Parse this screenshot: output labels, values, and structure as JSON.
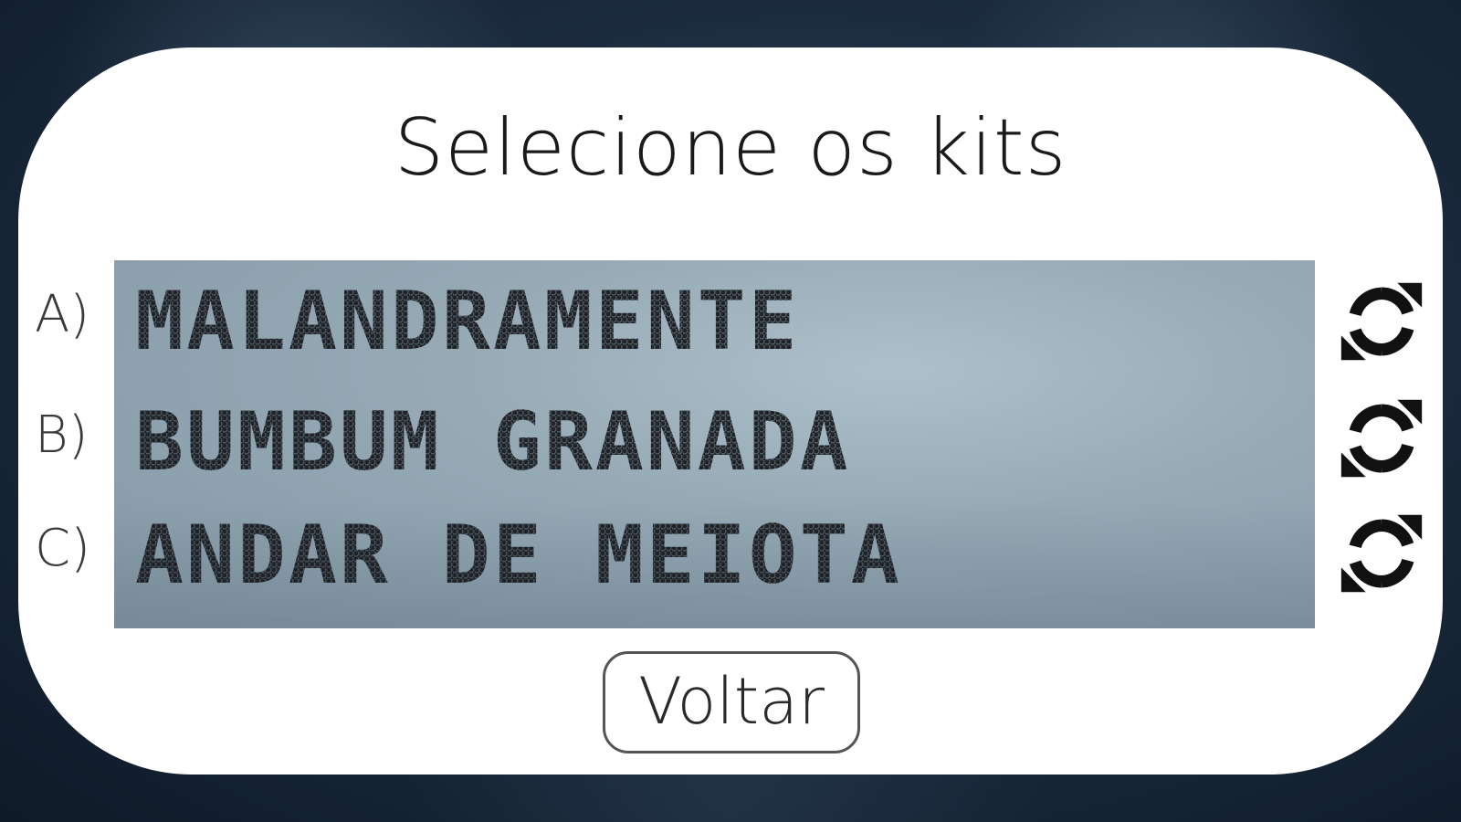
{
  "screen": {
    "title": "Selecione os kits",
    "back_label": "Voltar"
  },
  "kits": [
    {
      "label": "A)",
      "name": "MALANDRAMENTE",
      "refresh_icon": "refresh-icon"
    },
    {
      "label": "B)",
      "name": "BUMBUM GRANADA",
      "refresh_icon": "refresh-icon"
    },
    {
      "label": "C)",
      "name": "ANDAR DE MEIOTA",
      "refresh_icon": "refresh-icon"
    }
  ],
  "colors": {
    "panel": "#ffffff",
    "display": "#98a8b4",
    "dot_matrix_text": "#1e2226",
    "background": "#1c2c3f"
  }
}
